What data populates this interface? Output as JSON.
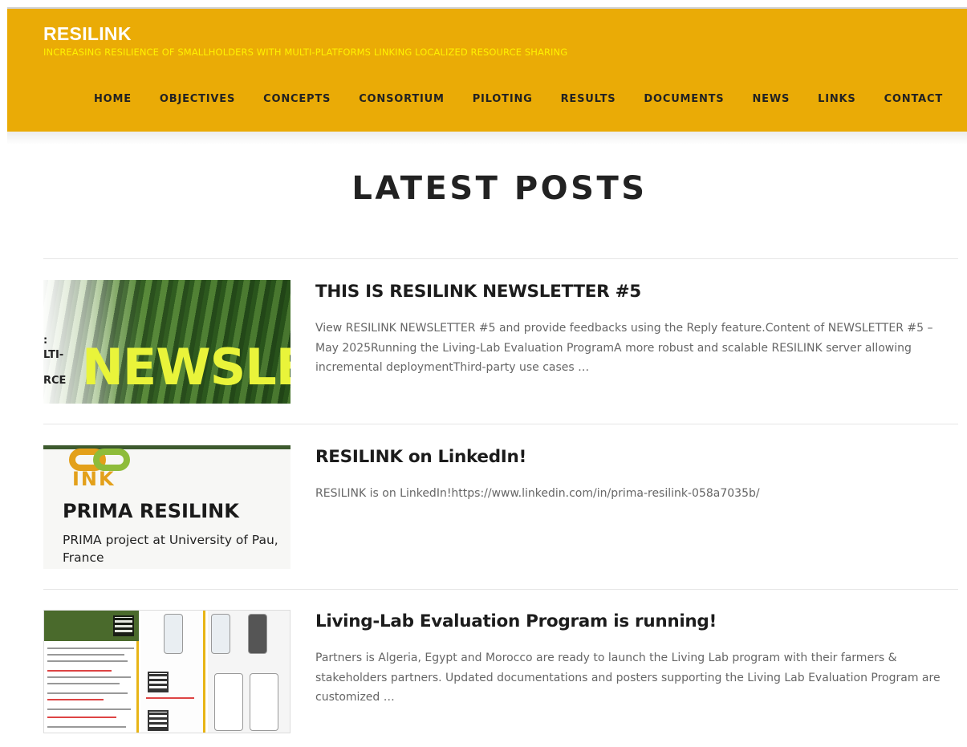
{
  "site": {
    "title": "RESILINK",
    "tagline": "INCREASING RESILIENCE OF SMALLHOLDERS WITH MULTI-PLATFORMS LINKING LOCALIZED RESOURCE SHARING"
  },
  "nav": {
    "items": [
      "HOME",
      "OBJECTIVES",
      "CONCEPTS",
      "CONSORTIUM",
      "PILOTING",
      "RESULTS",
      "DOCUMENTS",
      "NEWS",
      "LINKS",
      "CONTACT"
    ]
  },
  "page": {
    "title": "LATEST POSTS"
  },
  "posts": [
    {
      "title": "THIS IS RESILINK NEWSLETTER #5",
      "excerpt": "View RESILINK NEWSLETTER #5 and provide feedbacks using the Reply feature.Content of NEWSLETTER #5 – May 2025Running the Living-Lab Evaluation ProgramA more robust and scalable RESILINK server allowing incremental deploymentThird-party use cases …",
      "thumb_text": {
        "big": "NEWSLET",
        "a": ":",
        "b": "LTI-",
        "c": "RCE"
      }
    },
    {
      "title": "RESILINK on LinkedIn!",
      "excerpt": "RESILINK is on LinkedIn!https://www.linkedin.com/in/prima-resilink-058a7035b/",
      "thumb_text": {
        "ink": "INK",
        "name": "PRIMA RESILINK",
        "desc": "PRIMA project at University of Pau, France"
      }
    },
    {
      "title": "Living-Lab Evaluation Program is running!",
      "excerpt": "Partners is Algeria, Egypt and Morocco are ready to launch the Living Lab program with their farmers & stakeholders partners. Updated documentations and posters supporting the Living Lab Evaluation Program are customized …"
    }
  ],
  "colors": {
    "header_bg": "#eaab06",
    "tagline": "#fff200",
    "title_text": "#222222",
    "excerpt_text": "#666666"
  }
}
